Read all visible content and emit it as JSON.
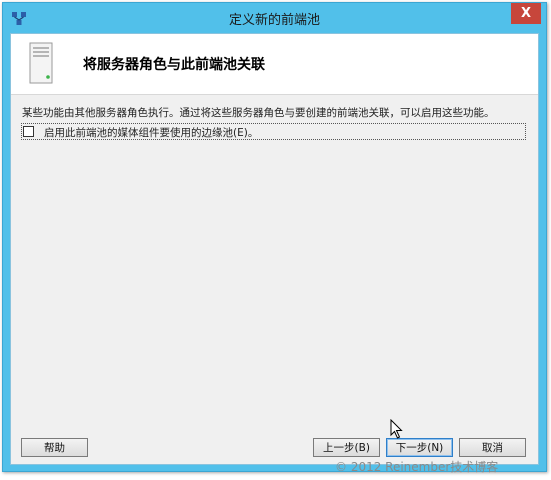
{
  "window": {
    "title": "定义新的前端池",
    "close_glyph": "X"
  },
  "header": {
    "title": "将服务器角色与此前端池关联",
    "icon": "server-icon"
  },
  "content": {
    "description": "某些功能由其他服务器角色执行。通过将这些服务器角色与要创建的前端池关联，可以启用这些功能。",
    "checkbox_label": "启用此前端池的媒体组件要使用的边缘池(E)。",
    "checkbox_checked": false
  },
  "buttons": {
    "help": "帮助",
    "back": "上一步(B)",
    "next": "下一步(N)",
    "cancel": "取消"
  },
  "watermark": "© 2012 Reinember技术博客",
  "colors": {
    "titlebar": "#51c0ea",
    "close": "#c7463b",
    "client_bg": "#f0f0f0",
    "header_bg": "#ffffff"
  }
}
